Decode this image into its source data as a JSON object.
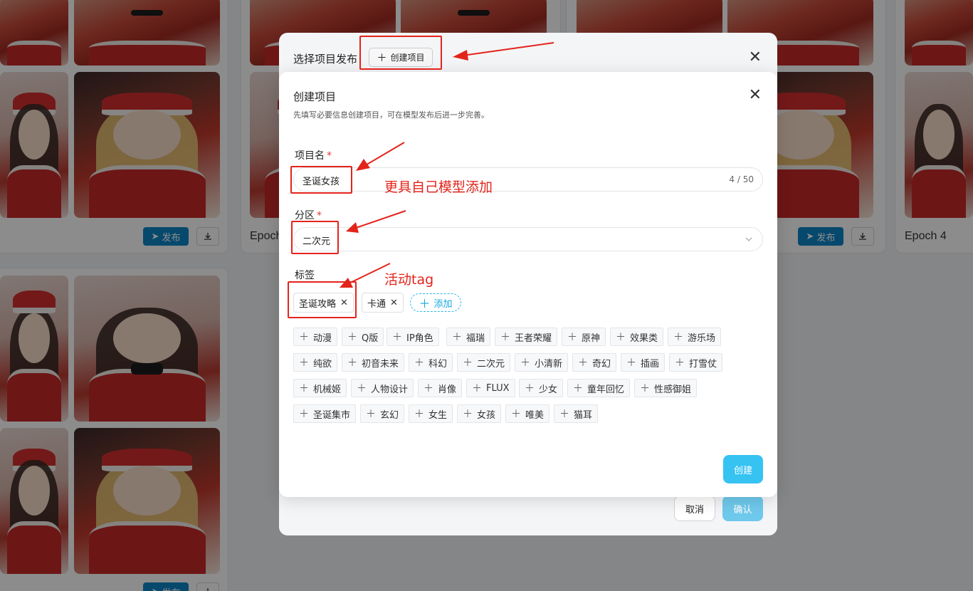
{
  "background": {
    "epoch_labels": [
      "Epoch",
      "Epoch 4"
    ],
    "publish_label": "发布"
  },
  "outer_dialog": {
    "title": "选择项目发布",
    "create_project_label": "创建项目",
    "cancel_label": "取消",
    "confirm_label": "确认"
  },
  "inner_dialog": {
    "title": "创建项目",
    "description": "先填写必要信息创建项目，可在模型发布后进一步完善。",
    "name_label": "项目名",
    "name_value": "圣诞女孩",
    "name_count": "4 / 50",
    "section_label": "分区",
    "section_value": "二次元",
    "tags_label": "标签",
    "selected_tags": [
      "圣诞攻略",
      "卡通"
    ],
    "add_tag_label": "添加",
    "tag_options": [
      [
        "动漫",
        "Q版",
        "IP角色",
        "福瑞",
        "王者荣耀",
        "原神",
        "效果类",
        "游乐场"
      ],
      [
        "纯欲",
        "初音未来",
        "科幻",
        "二次元",
        "小清新",
        "奇幻",
        "插画",
        "打雪仗"
      ],
      [
        "机械姬",
        "人物设计",
        "肖像",
        "FLUX",
        "少女",
        "童年回忆",
        "性感御姐"
      ],
      [
        "圣诞集市",
        "玄幻",
        "女生",
        "女孩",
        "唯美",
        "猫耳"
      ]
    ],
    "create_label": "创建"
  },
  "annotations": {
    "model_note": "更具自己模型添加",
    "tag_note": "活动tag"
  },
  "colors": {
    "accent": "#36c3f2",
    "annotation": "#e3241b",
    "publish": "#0e86c7"
  }
}
